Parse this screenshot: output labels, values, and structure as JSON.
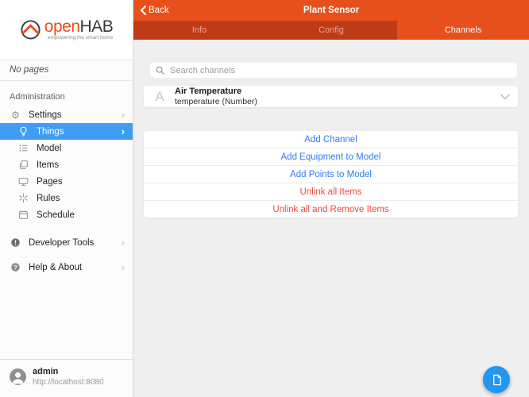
{
  "colors": {
    "brand_orange": "#e7501d",
    "tabbar_dark": "#bf3b15",
    "sidebar_active_blue": "#3f9ef4",
    "fab_blue": "#2196f3",
    "link_blue": "#2e7cf7",
    "danger_red": "#f2483c"
  },
  "sidebar": {
    "logo": {
      "brand_open": "open",
      "brand_hab": "HAB",
      "tagline": "empowering the smart home"
    },
    "no_pages": "No pages",
    "section_label": "Administration",
    "items": [
      {
        "label": "Settings",
        "icon": "gear-icon"
      },
      {
        "label": "Things",
        "icon": "lightbulb-icon",
        "active": true
      },
      {
        "label": "Model",
        "icon": "bullet-list-icon"
      },
      {
        "label": "Items",
        "icon": "copy-icon"
      },
      {
        "label": "Pages",
        "icon": "monitor-icon"
      },
      {
        "label": "Rules",
        "icon": "sparkle-icon"
      },
      {
        "label": "Schedule",
        "icon": "calendar-icon"
      }
    ],
    "secondary_items": [
      {
        "label": "Developer Tools",
        "icon": "exclamation-circle-icon"
      },
      {
        "label": "Help & About",
        "icon": "question-circle-icon"
      }
    ],
    "user": {
      "name": "admin",
      "url": "http://localhost:8080"
    }
  },
  "header": {
    "back_label": "Back",
    "title": "Plant Sensor",
    "tabs": [
      {
        "label": "Info"
      },
      {
        "label": "Config"
      },
      {
        "label": "Channels",
        "active": true
      }
    ]
  },
  "main": {
    "search_placeholder": "Search channels",
    "channel": {
      "letter": "A",
      "title": "Air Temperature",
      "subtitle": "temperature (Number)"
    },
    "actions": [
      {
        "label": "Add Channel",
        "style": "blue"
      },
      {
        "label": "Add Equipment to Model",
        "style": "blue"
      },
      {
        "label": "Add Points to Model",
        "style": "blue"
      },
      {
        "label": "Unlink all Items",
        "style": "red"
      },
      {
        "label": "Unlink all and Remove Items",
        "style": "red"
      }
    ]
  }
}
